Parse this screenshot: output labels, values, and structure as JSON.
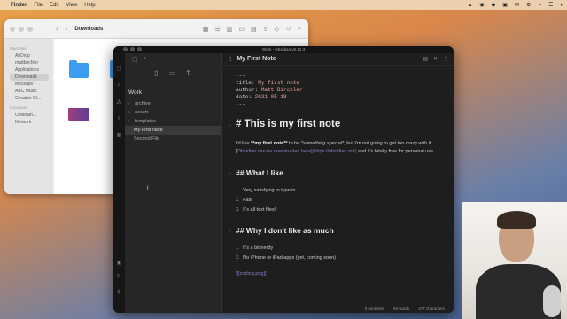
{
  "menubar": {
    "app": "Finder",
    "items": [
      "File",
      "Edit",
      "View",
      "Help"
    ]
  },
  "finder": {
    "title": "Downloads",
    "sidebar_sections": [
      {
        "title": "Favorites",
        "items": [
          "AirDrop",
          "mattbirchler",
          "Applications",
          "Downloads",
          "Mockups",
          "ABC Music",
          "Creative Cl..."
        ]
      },
      {
        "title": "Locations",
        "items": [
          "Obsidian...",
          "Network"
        ]
      }
    ],
    "active_item": "Downloads"
  },
  "obsidian": {
    "window_title": "Work - Obsidian v0.12.3",
    "vault_name": "Work",
    "tree": [
      {
        "name": "archive",
        "type": "folder"
      },
      {
        "name": "assets",
        "type": "folder"
      },
      {
        "name": "templates",
        "type": "folder"
      },
      {
        "name": "My First Note",
        "type": "file",
        "active": true
      },
      {
        "name": "Second File",
        "type": "file"
      }
    ],
    "tab_title": "My First Note",
    "frontmatter": {
      "open": "---",
      "title_key": "title:",
      "title_val": "My first note",
      "author_key": "author:",
      "author_val": "Matt Birchler",
      "date_key": "date:",
      "date_val": "2021-05-18",
      "close": "---"
    },
    "h1": "# This is my first note",
    "para_1a": "I'd like ",
    "para_1b": "**my first note**",
    "para_1c": " to be ",
    "para_1d": "*something special*",
    "para_1e": ", but I'm not going to get too crazy with it. [",
    "para_1f": "Obsidian can be downloaded here",
    "para_1g": "](https://obsidian.md)",
    "para_1h": " and it's totally free for personal use.",
    "h2_like": "## What I like",
    "likes": [
      {
        "num": "1.",
        "text": "Very satisfying to type in"
      },
      {
        "num": "2.",
        "text": "Fast"
      },
      {
        "num": "3.",
        "text": "It's all text files!"
      }
    ],
    "h2_dislike": "## Why I don't like as much",
    "dislikes": [
      {
        "num": "1.",
        "text": "It's a bit nerdy"
      },
      {
        "num": "2.",
        "text": "No iPhone or iPad apps (yet, coming soon)"
      }
    ],
    "embed": "![[coding.png]]",
    "status": {
      "backlinks": "0 backlinks",
      "words": "94 words",
      "chars": "477 characters"
    }
  },
  "colors": {
    "obsidian_bg": "#1e1e1e",
    "link": "#8a7cc8",
    "finder_folder": "#3e9cef"
  }
}
